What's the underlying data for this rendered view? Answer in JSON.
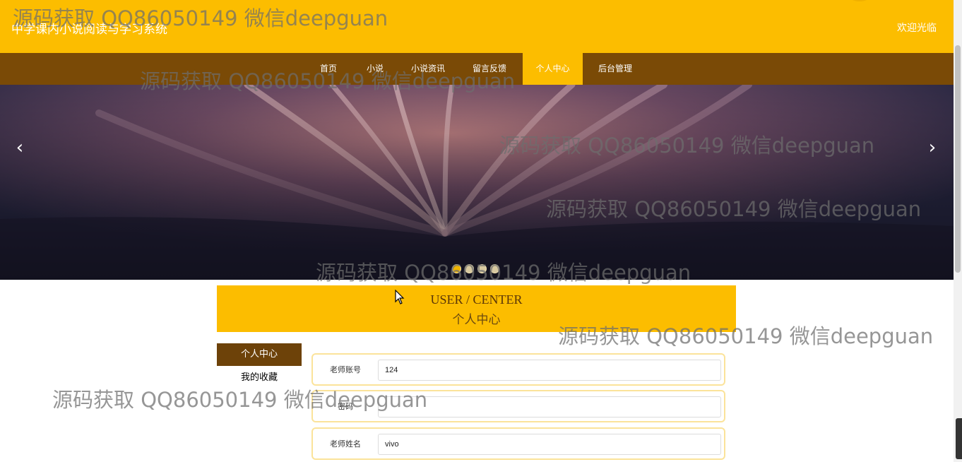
{
  "site": {
    "title": "中学课内小说阅读与学习系统",
    "welcome": "欢迎光临"
  },
  "nav": {
    "items": [
      {
        "label": "首页",
        "active": false
      },
      {
        "label": "小说",
        "active": false
      },
      {
        "label": "小说资讯",
        "active": false
      },
      {
        "label": "留言反馈",
        "active": false
      },
      {
        "label": "个人中心",
        "active": true
      },
      {
        "label": "后台管理",
        "active": false
      }
    ]
  },
  "banner": {
    "prev_icon": "chevron-left-icon",
    "next_icon": "chevron-right-icon",
    "prev_glyph": "‹",
    "next_glyph": "›",
    "slide_count": 4,
    "active_slide": 1
  },
  "user_center": {
    "title_en": "USER / CENTER",
    "title_cn": "个人中心"
  },
  "sidebar": {
    "items": [
      {
        "label": "个人中心",
        "active": true
      },
      {
        "label": "我的收藏",
        "active": false
      }
    ]
  },
  "form": {
    "fields": [
      {
        "label": "老师账号",
        "value": "124"
      },
      {
        "label": "密码",
        "value": ""
      },
      {
        "label": "老师姓名",
        "value": "vivo"
      }
    ]
  },
  "watermark": {
    "text": "源码获取 QQ86050149 微信deepguan"
  },
  "colors": {
    "primary": "#fcbd00",
    "nav_bg": "#7a4a06",
    "sidebar_active": "#6d4209"
  }
}
